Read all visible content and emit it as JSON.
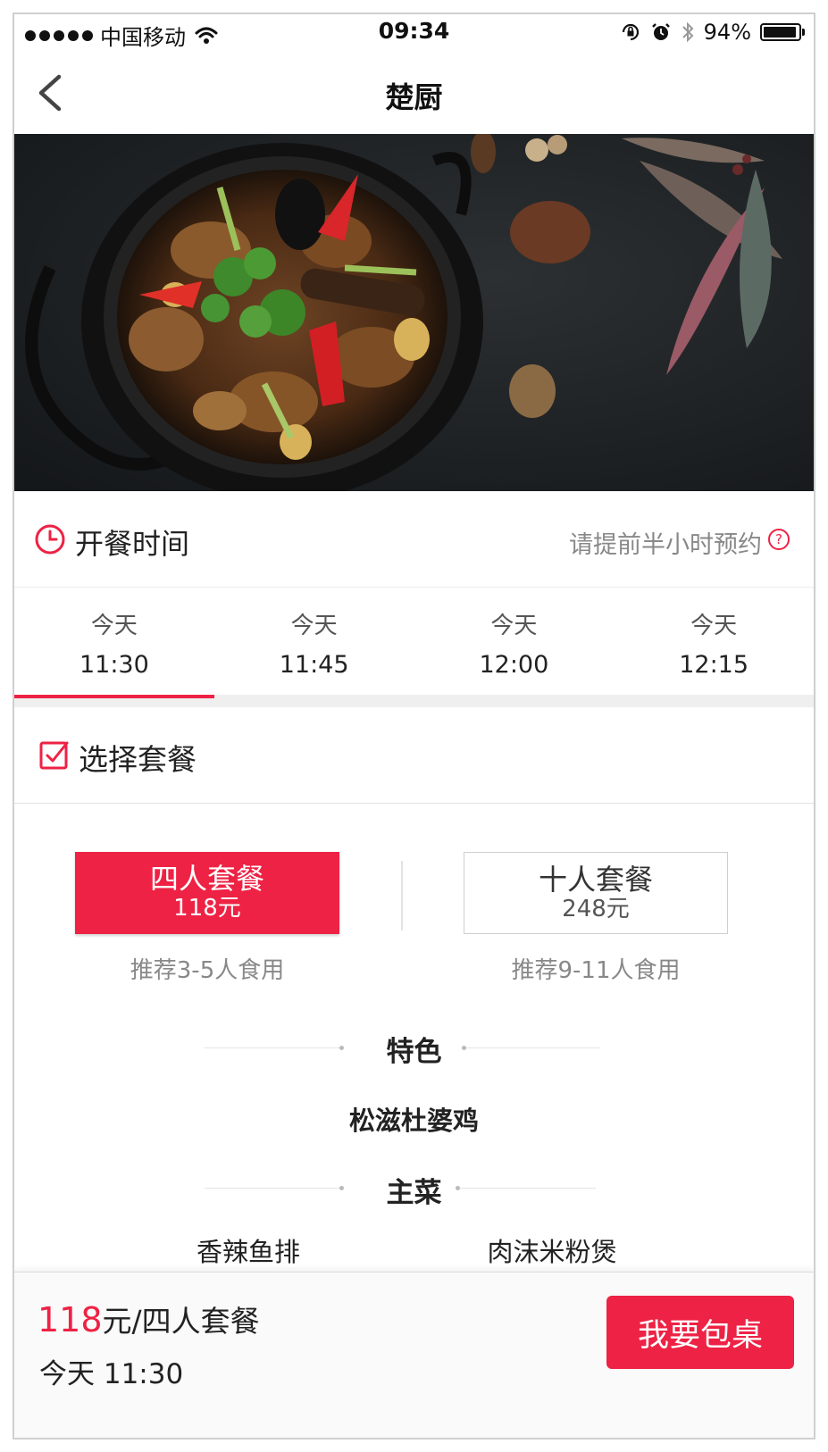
{
  "status_bar": {
    "carrier": "中国移动",
    "time": "09:34",
    "battery_text": "94%",
    "battery_level": 0.94
  },
  "nav": {
    "title": "楚厨"
  },
  "serve_time": {
    "title": "开餐时间",
    "hint": "请提前半小时预约",
    "slots": [
      {
        "day": "今天",
        "time": "11:30",
        "selected": true
      },
      {
        "day": "今天",
        "time": "11:45",
        "selected": false
      },
      {
        "day": "今天",
        "time": "12:00",
        "selected": false
      },
      {
        "day": "今天",
        "time": "12:15",
        "selected": false
      }
    ]
  },
  "package": {
    "title": "选择套餐",
    "options": [
      {
        "name": "四人套餐",
        "price": "118元",
        "recommend": "推荐3-5人食用",
        "selected": true
      },
      {
        "name": "十人套餐",
        "price": "248元",
        "recommend": "推荐9-11人食用",
        "selected": false
      }
    ]
  },
  "menu": {
    "specialty_title": "特色",
    "specialty_dish": "松滋杜婆鸡",
    "main_title": "主菜",
    "main_dishes": [
      "香辣鱼排",
      "肉沫米粉煲"
    ]
  },
  "bottom": {
    "price": "118",
    "price_suffix": "元/四人套餐",
    "selected_time": "今天 11:30",
    "book_label": "我要包桌"
  },
  "colors": {
    "accent": "#ee2244",
    "muted_text": "#888888"
  }
}
